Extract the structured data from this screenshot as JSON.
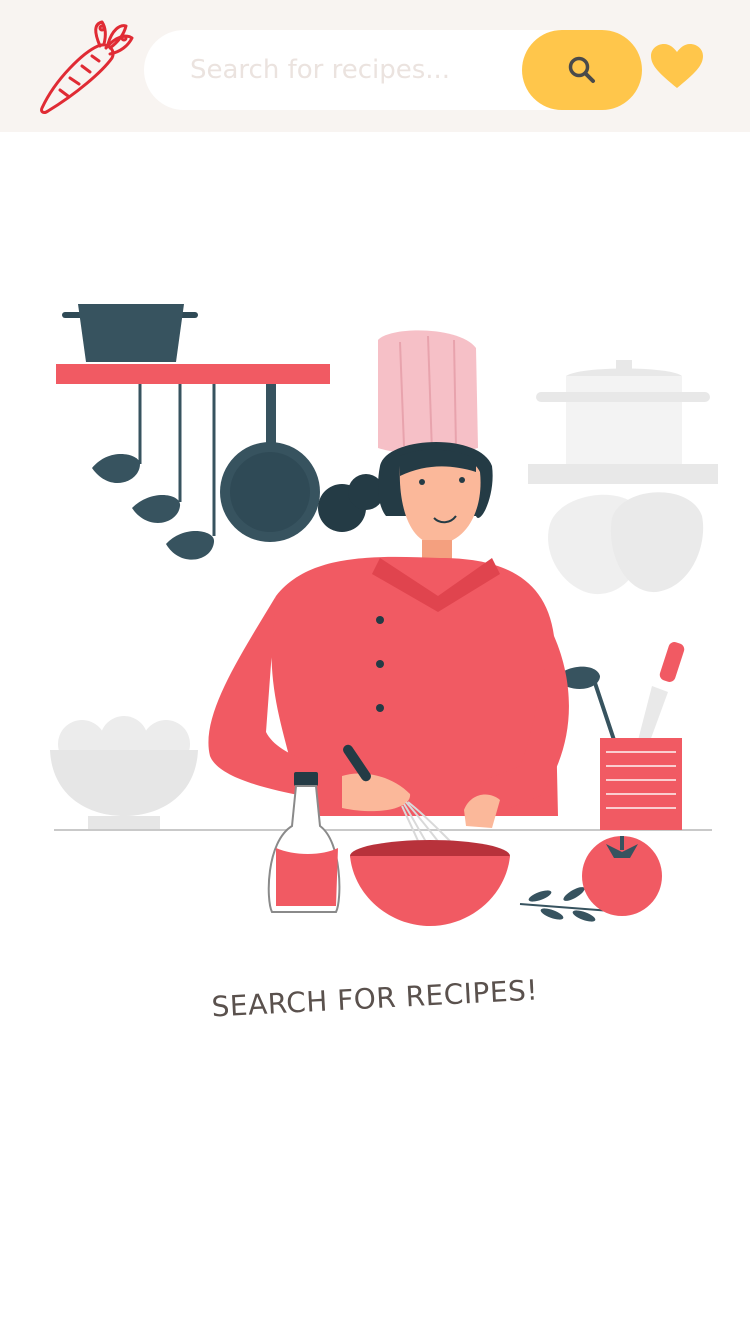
{
  "search": {
    "placeholder": "Search for recipes..."
  },
  "message": {
    "text": "SEARCH FOR RECIPES!"
  },
  "icons": {
    "logo": "carrot-icon",
    "search": "search-icon",
    "favorites": "heart-icon"
  },
  "colors": {
    "header_bg": "#f8f4f1",
    "accent_yellow": "#ffc64b",
    "brand_red": "#e02b34",
    "text": "#5a514d"
  }
}
